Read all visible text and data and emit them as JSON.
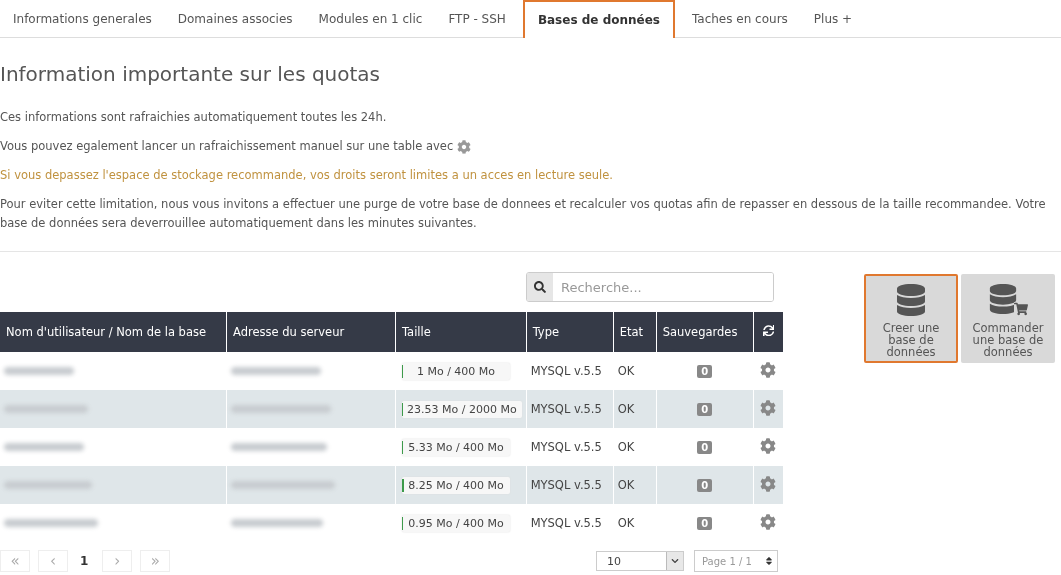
{
  "tabs": [
    {
      "label": "Informations generales",
      "selected": false
    },
    {
      "label": "Domaines associes",
      "selected": false
    },
    {
      "label": "Modules en 1 clic",
      "selected": false
    },
    {
      "label": "FTP - SSH",
      "selected": false
    },
    {
      "label": "Bases de données",
      "selected": true
    },
    {
      "label": "Taches en cours",
      "selected": false
    },
    {
      "label": "Plus +",
      "selected": false
    }
  ],
  "title": "Information importante sur les quotas",
  "paragraphs": [
    {
      "text": "Ces informations sont rafraichies automatiquement toutes les 24h.",
      "kind": "plain"
    },
    {
      "text": "Vous pouvez egalement lancer un rafraichissement manuel sur une table avec",
      "kind": "gear"
    },
    {
      "text": "Si vous depassez l'espace de stockage recommande, vos droits seront limites a un acces en lecture seule.",
      "kind": "warning"
    },
    {
      "text": "Pour eviter cette limitation, nous vous invitons a effectuer une purge de votre base de donnees et recalculer vos quotas afin de repasser en dessous de la taille recommandee. Votre base de données sera deverrouillee automatiquement dans les minutes suivantes.",
      "kind": "plain"
    }
  ],
  "search": {
    "placeholder": "Recherche..."
  },
  "table": {
    "columns": [
      "Nom d'utilisateur / Nom de la base",
      "Adresse du serveur",
      "Taille",
      "Type",
      "Etat",
      "Sauvegardes"
    ],
    "rows": [
      {
        "size": "1 Mo / 400 Mo",
        "level": 0.0025,
        "type": "MYSQL  v.5.5",
        "state": "OK",
        "backups": "0"
      },
      {
        "size": "23.53 Mo / 2000 Mo",
        "level": 0.012,
        "type": "MYSQL  v.5.5",
        "state": "OK",
        "backups": "0"
      },
      {
        "size": "5.33 Mo / 400 Mo",
        "level": 0.013,
        "type": "MYSQL  v.5.5",
        "state": "OK",
        "backups": "0"
      },
      {
        "size": "8.25 Mo / 400 Mo",
        "level": 0.021,
        "type": "MYSQL  v.5.5",
        "state": "OK",
        "backups": "0"
      },
      {
        "size": "0.95 Mo / 400 Mo",
        "level": 0.0024,
        "type": "MYSQL  v.5.5",
        "state": "OK",
        "backups": "0"
      }
    ]
  },
  "actions": [
    {
      "label": "Creer une base de données",
      "selected": true,
      "kind": "create"
    },
    {
      "label": "Commander une base de données",
      "selected": false,
      "kind": "order"
    }
  ],
  "pagination": {
    "first": "«",
    "prev": "‹",
    "page": "1",
    "next": "›",
    "last": "»",
    "per_page": "10",
    "page_info": "Page 1 / 1"
  }
}
